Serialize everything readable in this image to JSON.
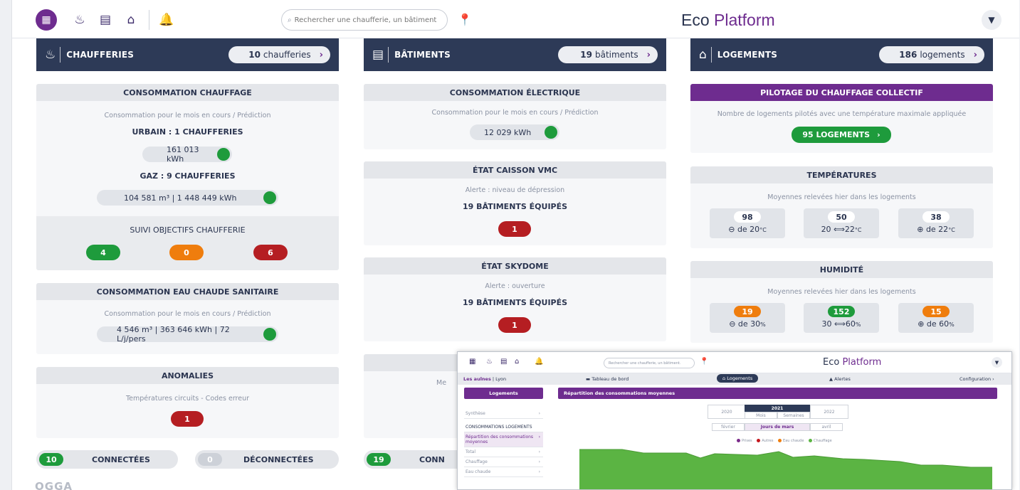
{
  "brand": {
    "eco": "Eco",
    "platform": "Platform"
  },
  "search": {
    "placeholder": "Rechercher une chaufferie, un bâtiment."
  },
  "columns": {
    "chaufferies": {
      "title": "CHAUFFERIES",
      "count": "10",
      "unit": "chaufferies"
    },
    "batiments": {
      "title": "BÂTIMENTS",
      "count": "19",
      "unit": "bâtiments"
    },
    "logements": {
      "title": "LOGEMENTS",
      "count": "186",
      "unit": "logements"
    }
  },
  "conso_chauffage": {
    "title": "CONSOMMATION CHAUFFAGE",
    "subtitle": "Consommation pour le mois en cours / Prédiction",
    "urbain": "URBAIN : 1 CHAUFFERIES",
    "urbain_value": "161 013 kWh",
    "gaz": "GAZ : 9 CHAUFFERIES",
    "gaz_value": "104 581 m³ | 1 448 449 kWh"
  },
  "suivi": {
    "title": "SUIVI OBJECTIFS CHAUFFERIE",
    "green": "4",
    "orange": "0",
    "red": "6"
  },
  "ecs": {
    "title": "CONSOMMATION EAU CHAUDE SANITAIRE",
    "subtitle": "Consommation pour le mois en cours / Prédiction",
    "value": "4 546 m³ | 363 646 kWh | 72 L/j/pers"
  },
  "anomalies": {
    "title": "ANOMALIES",
    "subtitle": "Températures circuits - Codes erreur",
    "count": "1"
  },
  "connections": {
    "connected_count": "10",
    "connected_label": "CONNECTÉES",
    "disconnected_count": "0",
    "disconnected_label": "DÉCONNECTÉES",
    "bat_connected_count": "19",
    "bat_connected_label": "CONN"
  },
  "conso_elec": {
    "title": "CONSOMMATION ÉLECTRIQUE",
    "subtitle": "Consommation pour le mois en cours / Prédiction",
    "value": "12 029 kWh"
  },
  "vmc": {
    "title": "ÉTAT CAISSON VMC",
    "subtitle": "Alerte : niveau de dépression",
    "equip": "19 BÂTIMENTS ÉQUIPÉS",
    "count": "1"
  },
  "skydome": {
    "title": "ÉTAT SKYDOME",
    "subtitle": "Alerte : ouverture",
    "equip": "19 BÂTIMENTS ÉQUIPÉS",
    "count": "1"
  },
  "hidden_card": {
    "subtitle_partial": "Me"
  },
  "pilotage": {
    "title": "PILOTAGE DU CHAUFFAGE COLLECTIF",
    "subtitle": "Nombre de logements pilotés avec une température maximale appliquée",
    "button": "95 LOGEMENTS"
  },
  "temperatures": {
    "title": "TEMPÉRATURES",
    "subtitle": "Moyennes relevées hier dans les logements",
    "boxes": [
      {
        "value": "98",
        "pre": "de 20",
        "unit": "°C"
      },
      {
        "value": "50",
        "a": "20",
        "b": "22",
        "unit": "°C"
      },
      {
        "value": "38",
        "pre": "de 22",
        "unit": "°C"
      }
    ]
  },
  "humidite": {
    "title": "HUMIDITÉ",
    "subtitle": "Moyennes relevées hier dans les logements",
    "boxes": [
      {
        "value": "19",
        "pre": "de 30",
        "unit": "%"
      },
      {
        "value": "152",
        "a": "30",
        "b": "60",
        "unit": "%"
      },
      {
        "value": "15",
        "pre": "de 60",
        "unit": "%"
      }
    ]
  },
  "footer_logo": "OGGA",
  "overlay": {
    "search_placeholder": "Rechercher une chaufferie, un bâtiment.",
    "brand": {
      "eco": "Eco",
      "platform": "Platform"
    },
    "nav": {
      "site": "Les aulnes",
      "city": "| Lyon",
      "dashboard": "Tableau de bord",
      "logements": "Logements",
      "alertes": "Alertes",
      "config": "Configuration"
    },
    "side": {
      "header": "Logements",
      "items": [
        "Synthèse",
        "CONSOMMATIONS LOGEMENTS",
        "Répartition des consommations moyennes",
        "Total",
        "Chauffage",
        "Eau chaude"
      ]
    },
    "main_title": "Répartition des consommations moyennes",
    "years": [
      "2020",
      "2021",
      "2022"
    ],
    "year_tabs": [
      "Mois",
      "Semaines"
    ],
    "months": [
      "février",
      "Jours de mars",
      "avril"
    ],
    "legend": [
      "Prises",
      "Autres",
      "Eau chaude",
      "Chauffage"
    ],
    "colors": {
      "prises": "#7a2a8a",
      "autres": "#c4161c",
      "eau_chaude": "#ef7d0d",
      "chauffage": "#5bb443"
    }
  },
  "colors": {
    "navy": "#2d3a57",
    "purple": "#6e2c8f",
    "green": "#1e9b3c",
    "orange": "#ef7d0d",
    "red": "#b51e22"
  }
}
